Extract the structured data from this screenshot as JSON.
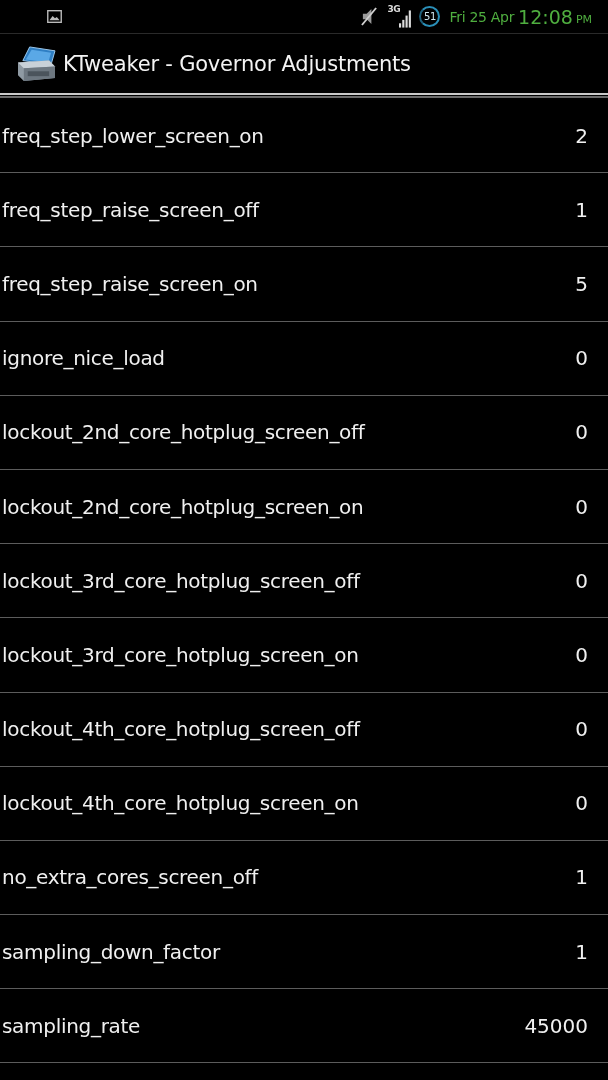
{
  "status_bar": {
    "network": "3G",
    "battery": "51",
    "date": "Fri 25 Apr",
    "time": "12:08",
    "meridiem": "PM"
  },
  "title_bar": {
    "title": "KTweaker - Governor Adjustments"
  },
  "settings": [
    {
      "name": "freq_step_lower_screen_on",
      "value": "2"
    },
    {
      "name": "freq_step_raise_screen_off",
      "value": "1"
    },
    {
      "name": "freq_step_raise_screen_on",
      "value": "5"
    },
    {
      "name": "ignore_nice_load",
      "value": "0"
    },
    {
      "name": "lockout_2nd_core_hotplug_screen_off",
      "value": "0"
    },
    {
      "name": "lockout_2nd_core_hotplug_screen_on",
      "value": "0"
    },
    {
      "name": "lockout_3rd_core_hotplug_screen_off",
      "value": "0"
    },
    {
      "name": "lockout_3rd_core_hotplug_screen_on",
      "value": "0"
    },
    {
      "name": "lockout_4th_core_hotplug_screen_off",
      "value": "0"
    },
    {
      "name": "lockout_4th_core_hotplug_screen_on",
      "value": "0"
    },
    {
      "name": "no_extra_cores_screen_off",
      "value": "1"
    },
    {
      "name": "sampling_down_factor",
      "value": "1"
    },
    {
      "name": "sampling_rate",
      "value": "45000"
    }
  ]
}
